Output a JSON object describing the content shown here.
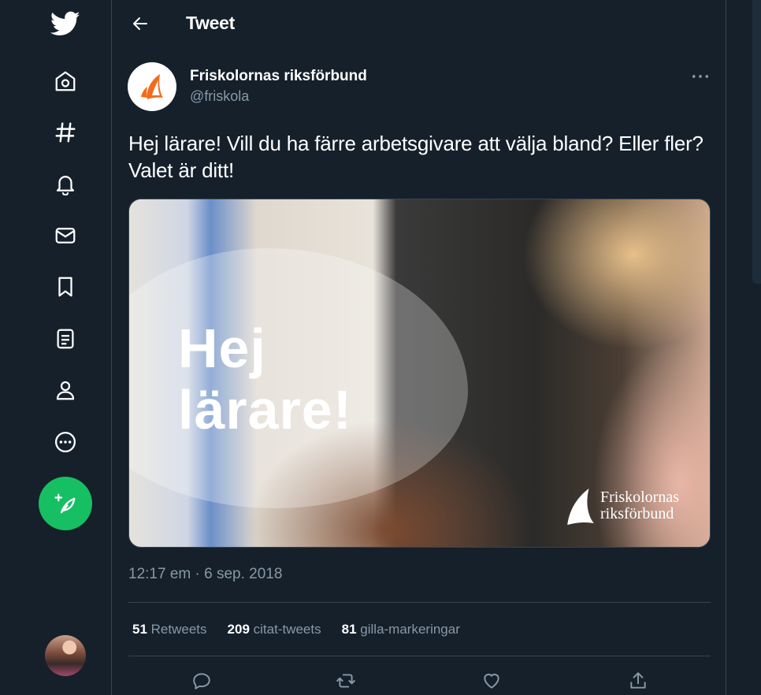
{
  "header": {
    "title": "Tweet"
  },
  "nav": {
    "items": [
      "twitter-logo",
      "home-icon",
      "explore-hashtag-icon",
      "notifications-bell-icon",
      "messages-mail-icon",
      "bookmarks-icon",
      "lists-icon",
      "profile-icon",
      "more-icon"
    ],
    "compose_icon": "feather-plus-icon"
  },
  "tweet": {
    "author_name": "Friskolornas riksförbund",
    "author_handle": "@friskola",
    "text": "Hej lärare! Vill du ha färre arbetsgivare att välja bland? Eller fler? Valet är ditt!",
    "media": {
      "overlay_line1": "Hej",
      "overlay_line2": "lärare!",
      "brand_line1": "Friskolornas",
      "brand_line2": "riksförbund"
    },
    "timestamp": "12:17 em · 6 sep. 2018",
    "stats": {
      "retweets_count": "51",
      "retweets_label": "Retweets",
      "quotes_count": "209",
      "quotes_label": "citat-tweets",
      "likes_count": "81",
      "likes_label": "gilla-markeringar"
    }
  },
  "colors": {
    "background": "#15202b",
    "border": "#38444d",
    "muted": "#8899a6",
    "accent_green": "#17bf63",
    "brand_orange": "#f26b1d"
  }
}
